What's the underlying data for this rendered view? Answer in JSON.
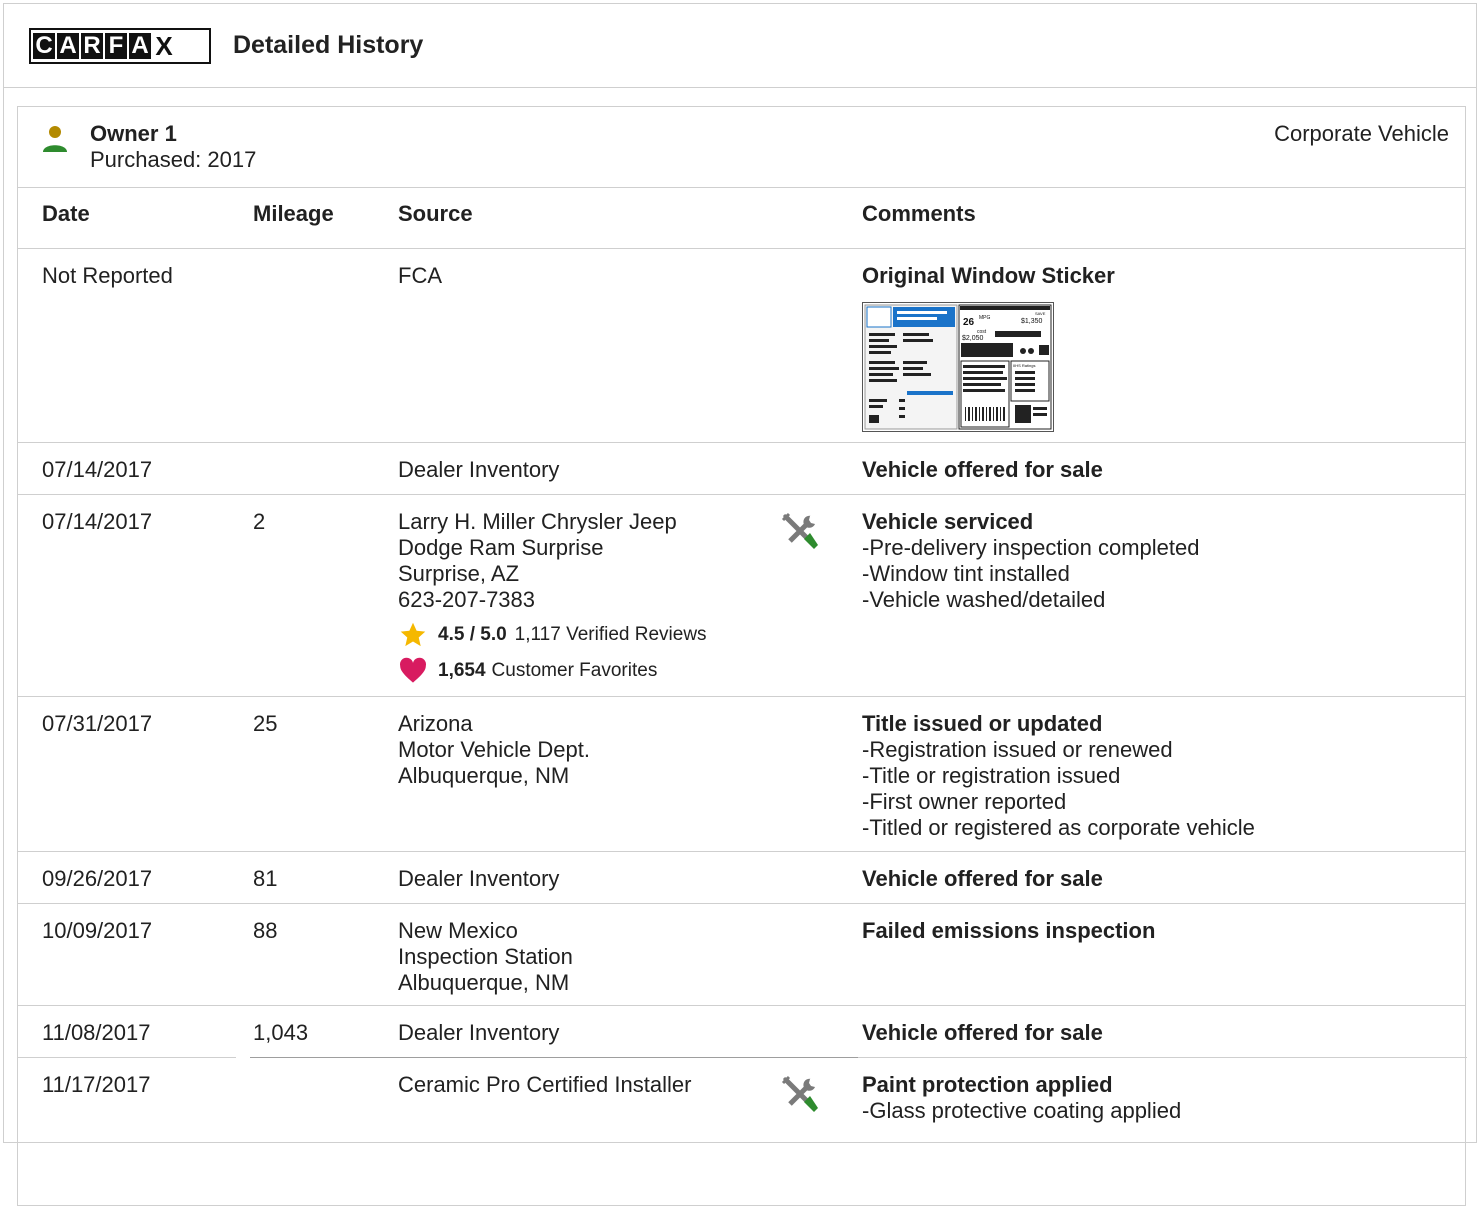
{
  "header": {
    "logo_letters": [
      "C",
      "A",
      "R",
      "F",
      "A",
      "X"
    ],
    "title": "Detailed History"
  },
  "owner": {
    "name": "Owner 1",
    "purchased": "Purchased: 2017",
    "type": "Corporate Vehicle"
  },
  "columns": {
    "date": "Date",
    "mileage": "Mileage",
    "source": "Source",
    "comments": "Comments"
  },
  "rows": [
    {
      "date": "Not Reported",
      "mileage": "",
      "source": [
        "FCA"
      ],
      "comment_title": "Original Window Sticker",
      "comment_items": []
    },
    {
      "date": "07/14/2017",
      "mileage": "",
      "source": [
        "Dealer Inventory"
      ],
      "comment_title": "Vehicle offered for sale",
      "comment_items": []
    },
    {
      "date": "07/14/2017",
      "mileage": "2",
      "source": [
        "Larry H. Miller Chrysler Jeep",
        "Dodge Ram Surprise",
        "Surprise, AZ",
        "623-207-7383"
      ],
      "rating": "4.5 / 5.0",
      "reviews": "1,117 Verified Reviews",
      "favorites_count": "1,654",
      "favorites_label": "Customer Favorites",
      "comment_title": "Vehicle serviced",
      "comment_items": [
        "Pre-delivery inspection completed",
        "Window tint installed",
        "Vehicle washed/detailed"
      ]
    },
    {
      "date": "07/31/2017",
      "mileage": "25",
      "source": [
        "Arizona",
        "Motor Vehicle Dept.",
        "Albuquerque, NM"
      ],
      "comment_title": "Title issued or updated",
      "comment_items": [
        "Registration issued or renewed",
        "Title or registration issued",
        "First owner reported",
        "Titled or registered as corporate vehicle"
      ]
    },
    {
      "date": "09/26/2017",
      "mileage": "81",
      "source": [
        "Dealer Inventory"
      ],
      "comment_title": "Vehicle offered for sale",
      "comment_items": []
    },
    {
      "date": "10/09/2017",
      "mileage": "88",
      "source": [
        "New Mexico",
        "Inspection Station",
        "Albuquerque, NM"
      ],
      "comment_title": "Failed emissions inspection",
      "comment_items": []
    },
    {
      "date": "11/08/2017",
      "mileage": "1,043",
      "source": [
        "Dealer Inventory"
      ],
      "comment_title": "Vehicle offered for sale",
      "comment_items": []
    },
    {
      "date": "11/17/2017",
      "mileage": "",
      "source": [
        "Ceramic Pro Certified Installer"
      ],
      "comment_title": "Paint protection applied",
      "comment_items": [
        "Glass protective coating applied"
      ]
    }
  ],
  "sticker": {
    "mpg": "26",
    "mpg_unit": "MPG",
    "save_label": "SAVE",
    "save_amount": "$1,350",
    "cost_label": "cost",
    "cost_amount": "$2,050",
    "ihs_label": "IIHS Ratings"
  },
  "colors": {
    "owner_head": "#b38a00",
    "owner_body": "#2e8b2e",
    "tool_green": "#2e8b2e",
    "star": "#f5b800",
    "heart": "#d81b60",
    "sticker_blue": "#1a73c9"
  }
}
